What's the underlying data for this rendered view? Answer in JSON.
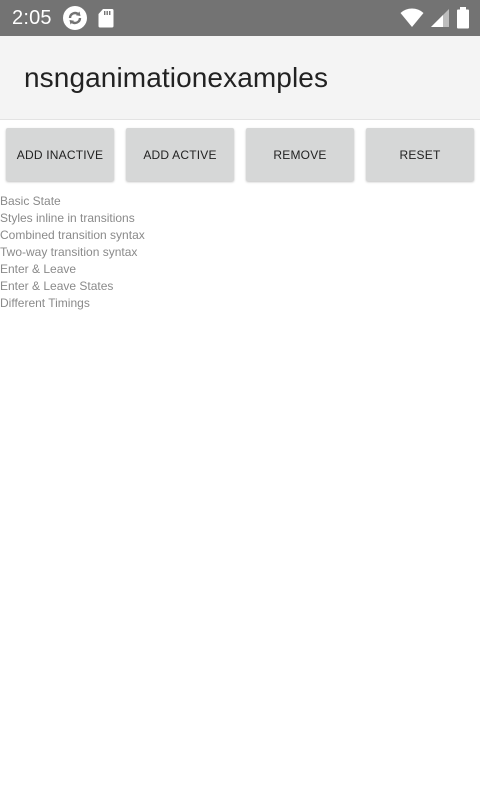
{
  "status_bar": {
    "time": "2:05",
    "left_icons": [
      "sync-icon",
      "sd-card-icon"
    ],
    "right_icons": [
      "wifi-icon",
      "cell-signal-icon",
      "battery-icon"
    ],
    "background_color": "#737373"
  },
  "toolbar": {
    "title": "nsnganimationexamples",
    "background_color": "#f4f4f4"
  },
  "buttons": [
    {
      "label": "ADD INACTIVE"
    },
    {
      "label": "ADD ACTIVE"
    },
    {
      "label": "REMOVE"
    },
    {
      "label": "RESET"
    }
  ],
  "examples": [
    "Basic State",
    "Styles inline in transitions",
    "Combined transition syntax",
    "Two-way transition syntax",
    "Enter & Leave",
    "Enter & Leave States",
    "Different Timings"
  ],
  "colors": {
    "button_bg": "#d6d7d7",
    "example_text": "#8a8a8a"
  }
}
